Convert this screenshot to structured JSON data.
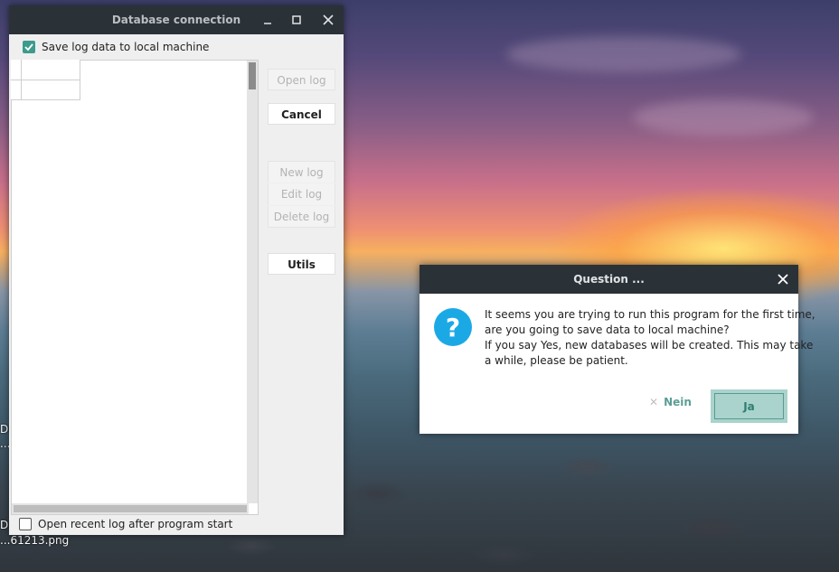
{
  "desktop": {
    "labels": [
      "De",
      "...",
      "De",
      "...61213.png"
    ]
  },
  "main_window": {
    "title": "Database connection",
    "save_log_checkbox": {
      "label": "Save log data to local machine",
      "checked": true
    },
    "open_recent_checkbox": {
      "label": "Open recent log after program start",
      "checked": false
    },
    "buttons": {
      "open_log": "Open log",
      "cancel": "Cancel",
      "new_log": "New log",
      "edit_log": "Edit log",
      "delete_log": "Delete log",
      "utils": "Utils"
    }
  },
  "dialog": {
    "title": "Question ...",
    "message_lines": [
      "It seems you are trying to run this program for the first time,",
      "are you going to save data to local machine?",
      "If you say Yes, new databases will be created. This may take",
      "a while, please be patient."
    ],
    "no_label": "Nein",
    "yes_label": "Ja"
  },
  "colors": {
    "titlebar": "#2b3237",
    "accent": "#3d9b8d",
    "question_icon": "#1ba9e6"
  }
}
